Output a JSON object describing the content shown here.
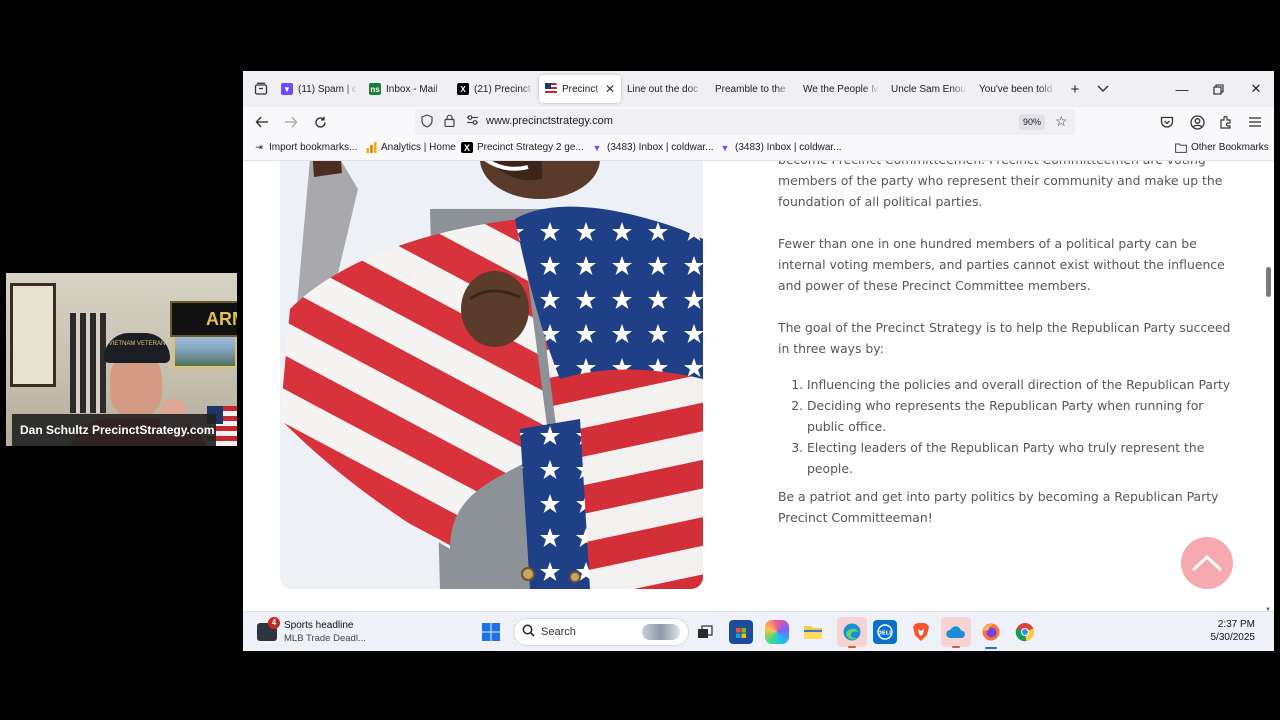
{
  "webcam": {
    "caption": "Dan Schultz PrecinctStrategy.com",
    "sign_text": "ARM",
    "cap_text": "VIETNAM VETERAN"
  },
  "browser": {
    "tabs": [
      {
        "label": "(11) Spam | c",
        "icon": "proton-mail-icon",
        "color": "#6d4aff"
      },
      {
        "label": "Inbox - Mail",
        "icon": "netsuite-icon",
        "color": "#1d7d3f"
      },
      {
        "label": "(21) Precinct",
        "icon": "x-logo-icon",
        "color": "#000000"
      },
      {
        "label": "Precinct S",
        "icon": "us-flag-icon",
        "active": true
      },
      {
        "label": "Line out the doc"
      },
      {
        "label": "Preamble to the"
      },
      {
        "label": "We the People M"
      },
      {
        "label": "Uncle Sam Enou"
      },
      {
        "label": "You've been told"
      }
    ],
    "url": "www.precinctstrategy.com",
    "zoom": "90%",
    "bookmarks": [
      {
        "label": "Import bookmarks...",
        "icon": "import-icon"
      },
      {
        "label": "Analytics | Home",
        "icon": "analytics-icon"
      },
      {
        "label": "Precinct Strategy 2 ge...",
        "icon": "x-logo-icon"
      },
      {
        "label": "(3483) Inbox | coldwar...",
        "icon": "proton-mail-icon"
      },
      {
        "label": "(3483) Inbox | coldwar...",
        "icon": "proton-mail-icon"
      }
    ],
    "other_bookmarks": "Other Bookmarks"
  },
  "article": {
    "cut_line": "become Precinct Committeemen. Precinct Committeemen are voting",
    "p1_rest": "members of the party who represent their community and make up the foundation of all political parties.",
    "p2": "Fewer than one in one hundred members of a political party can be internal voting members, and parties cannot exist without the influence and power of these Precinct Committee members.",
    "p3": "The goal of the Precinct Strategy is to help the Republican Party succeed in three ways by:",
    "list": [
      "Influencing the policies and overall direction of the Republican Party",
      "Deciding who represents the Republican Party when running for public office.",
      "Electing leaders of the Republican Party who truly represent the people."
    ],
    "closing": "Be a patriot and get into party politics by becoming a Republican Party Precinct Committeeman!"
  },
  "taskbar": {
    "news_title": "Sports headline",
    "news_sub": "MLB Trade Deadl...",
    "news_badge": "4",
    "search_label": "Search",
    "time": "2:37 PM",
    "date": "5/30/2025",
    "apps": [
      "start-icon",
      "task-view-icon",
      "store-icon",
      "copilot-icon",
      "file-explorer-icon",
      "edge-icon",
      "dell-icon",
      "brave-icon",
      "onedrive-icon",
      "firefox-icon",
      "chrome-icon"
    ]
  },
  "colors": {
    "accent_pink": "#f7a9b0",
    "body_text": "#55575d",
    "tab_bg": "#f0f0f4"
  }
}
